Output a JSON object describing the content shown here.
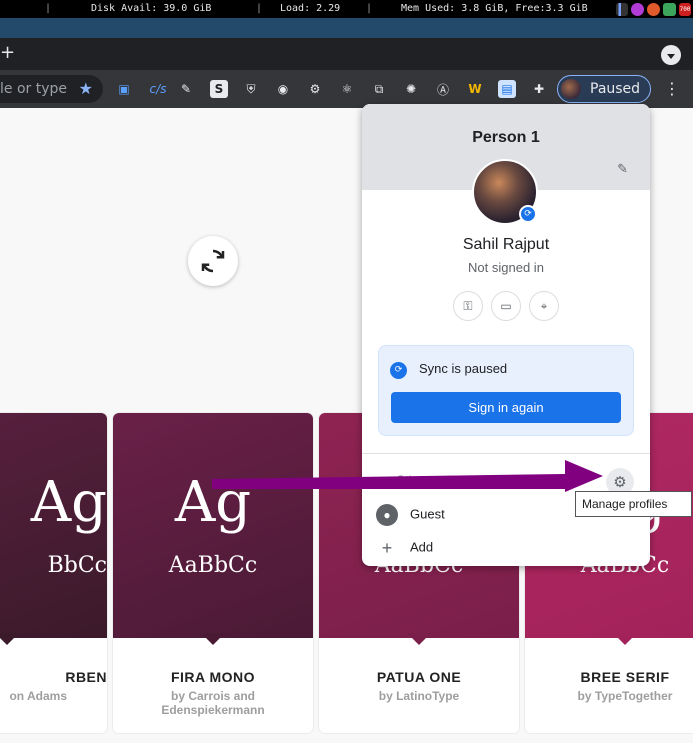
{
  "statusbar": {
    "disk": "Disk Avail: 39.0 GiB",
    "load": "Load: 2.29",
    "mem": "Mem Used: 3.8 GiB, Free:3.3 GiB",
    "tray_badge": "700"
  },
  "tabstrip": {
    "new_tab": "+"
  },
  "toolbar": {
    "omnibox_text": "le or type",
    "extensions": [
      {
        "name": "extension-x-icon",
        "glyph": "▣"
      },
      {
        "name": "cjs-icon",
        "glyph": "c/s"
      },
      {
        "name": "feather-icon",
        "glyph": "✎"
      },
      {
        "name": "s-icon",
        "glyph": "S"
      },
      {
        "name": "ublock-icon",
        "glyph": "⛨"
      },
      {
        "name": "eyes-icon",
        "glyph": "◉"
      },
      {
        "name": "gear-extension-icon",
        "glyph": "⚙"
      },
      {
        "name": "react-icon",
        "glyph": "⚛"
      },
      {
        "name": "copy-icon",
        "glyph": "⧉"
      },
      {
        "name": "globe-icon",
        "glyph": "✺"
      },
      {
        "name": "a-circle-icon",
        "glyph": "Ⓐ"
      },
      {
        "name": "w-icon",
        "glyph": "W"
      },
      {
        "name": "clipboard-icon",
        "glyph": "▤"
      },
      {
        "name": "puzzle-icon",
        "glyph": "✚"
      }
    ],
    "profile_chip": "Paused",
    "menu": "⋮"
  },
  "fonts": [
    {
      "display_top": "Ag",
      "display_bottom": "BbCc",
      "name": "RBEN",
      "by": "on Adams",
      "color1": "#3b1a2a",
      "color2": "#5a2040"
    },
    {
      "display_top": "Ag",
      "display_bottom": "AaBbCc",
      "name": "FIRA MONO",
      "by": "by Carrois and Edenspiekermann",
      "color1": "#4a1a35",
      "color2": "#6a2048"
    },
    {
      "display_top": "",
      "display_bottom": "AaBbCc",
      "name": "PATUA ONE",
      "by": "by LatinoType",
      "color1": "#7a1f4a",
      "color2": "#8f2352"
    },
    {
      "display_top": "g",
      "display_bottom": "AaBbCc",
      "name": "BREE SERIF",
      "by": "by TypeTogether",
      "color1": "#a3225a",
      "color2": "#b02862"
    }
  ],
  "profile_menu": {
    "person_label": "Person 1",
    "user_name": "Sahil Rajput",
    "status": "Not signed in",
    "sync_status": "Sync is paused",
    "sign_in_button": "Sign in again",
    "other_profiles": "Other profiles",
    "guest": "Guest",
    "add": "Add",
    "quick_icons": [
      "key-icon",
      "card-icon",
      "location-icon"
    ]
  },
  "tooltip": "Manage profiles",
  "colors": {
    "accent": "#1a73e8",
    "annotation_arrow": "#800080"
  }
}
